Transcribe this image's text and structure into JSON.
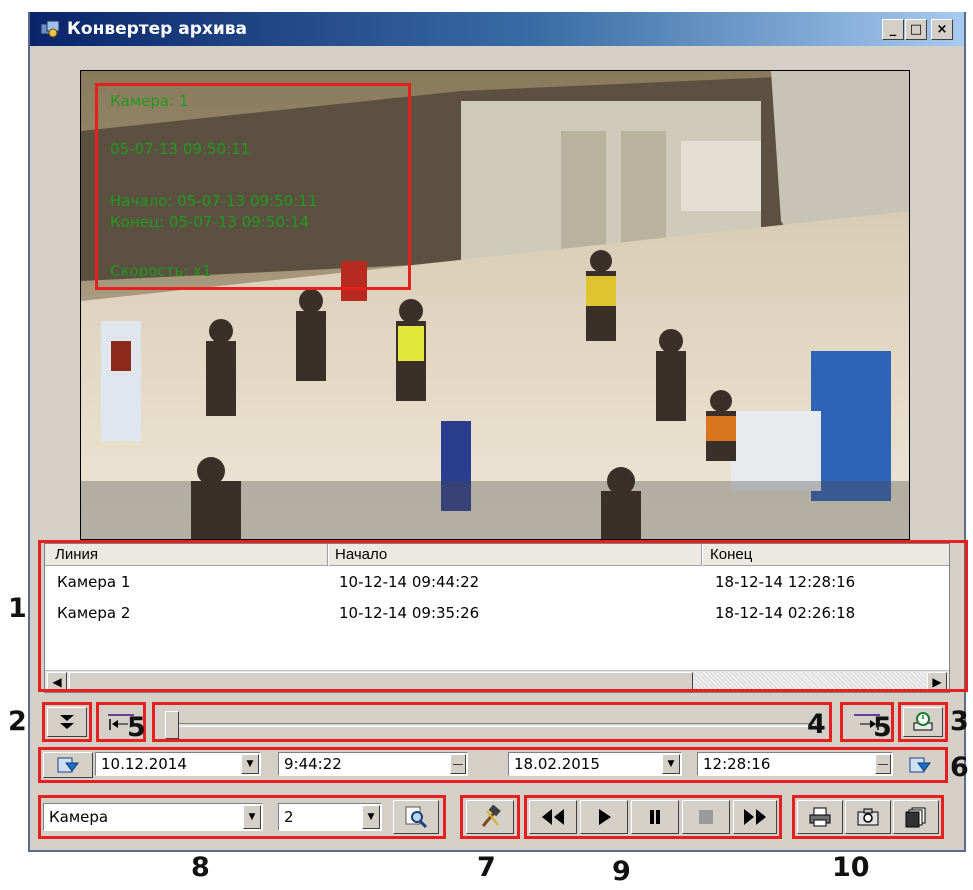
{
  "window": {
    "title": "Конвертер архива"
  },
  "overlay": {
    "camera": "Камера: 1",
    "datetime": "05-07-13 09:50:11",
    "start": "Начало: 05-07-13 09:50:11",
    "end": "Конец: 05-07-13 09:50:14",
    "speed": "Скорость: x1"
  },
  "table": {
    "columns": [
      "Линия",
      "Начало",
      "Конец"
    ],
    "rows": [
      [
        "Камера 1",
        "10-12-14 09:44:22",
        "18-12-14 12:28:16"
      ],
      [
        "Камера 2",
        "10-12-14 09:35:26",
        "18-12-14 02:26:18"
      ]
    ]
  },
  "slider": {
    "position": 0
  },
  "range": {
    "start_date": "10.12.2014",
    "start_time": "9:44:22",
    "end_date": "18.02.2015",
    "end_time": "12:28:16"
  },
  "bottom": {
    "object_type": "Камера",
    "object_id": "2"
  },
  "callouts": [
    "1",
    "2",
    "3",
    "4",
    "5",
    "5",
    "6",
    "7",
    "8",
    "9",
    "10"
  ],
  "icons": [
    "window-icon",
    "minimize-icon",
    "maximize-icon",
    "close-icon",
    "expand-down-icon",
    "go-start-icon",
    "go-end-icon",
    "export-icon",
    "calendar-start-icon",
    "calendar-end-icon",
    "search-icon",
    "settings-icon",
    "rewind-icon",
    "play-icon",
    "pause-icon",
    "stop-icon",
    "fast-forward-icon",
    "print-icon",
    "snapshot-icon",
    "save-frames-icon"
  ],
  "colors": {
    "annotation": "#e81f1f",
    "overlay_text": "#1f9a1f",
    "titlebar": "#0a246a",
    "panel": "#d4d0c8"
  }
}
